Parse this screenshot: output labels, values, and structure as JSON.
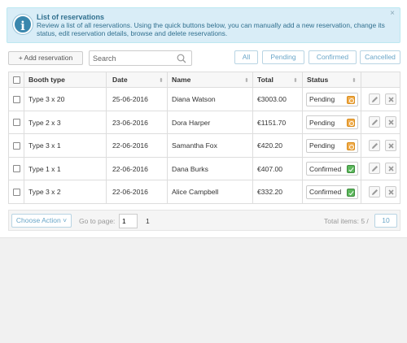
{
  "info": {
    "title": "List of reservations",
    "text": "Review a list of all reservations. Using the quick buttons below, you can manually add a new reservation, change its status, edit reservation details, browse and delete reservations.",
    "icon": "info-icon",
    "close": "×"
  },
  "toolbar": {
    "add_label": "+ Add reservation",
    "search_placeholder": "Search",
    "filters": [
      "All",
      "Pending",
      "Confirmed",
      "Cancelled"
    ]
  },
  "table": {
    "headers": {
      "booth_type": "Booth type",
      "date": "Date",
      "name": "Name",
      "total": "Total",
      "status": "Status"
    },
    "rows": [
      {
        "booth": "Type 3 x 20",
        "date": "25-06-2016",
        "name": "Diana Watson",
        "total": "€3003.00",
        "status": "Pending",
        "status_icon": "clock-icon"
      },
      {
        "booth": "Type 2 x 3",
        "date": "23-06-2016",
        "name": "Dora Harper",
        "total": "€1151.70",
        "status": "Pending",
        "status_icon": "clock-icon"
      },
      {
        "booth": "Type 3 x 1",
        "date": "22-06-2016",
        "name": "Samantha Fox",
        "total": "€420.20",
        "status": "Pending",
        "status_icon": "clock-icon"
      },
      {
        "booth": "Type 1 x 1",
        "date": "22-06-2016",
        "name": "Dana Burks",
        "total": "€407.00",
        "status": "Confirmed",
        "status_icon": "check-icon"
      },
      {
        "booth": "Type 3 x 2",
        "date": "22-06-2016",
        "name": "Alice Campbell",
        "total": "€332.20",
        "status": "Confirmed",
        "status_icon": "check-icon"
      }
    ]
  },
  "footer": {
    "choose_action": "Choose Action ˅",
    "goto_label": "Go to page:",
    "goto_value": "1",
    "page_count": "1",
    "total_label": "Total items: 5 /",
    "per_page": "10"
  },
  "colors": {
    "info_bg": "#d9edf7",
    "accent": "#6aa6c8",
    "pending": "#f0ad4e",
    "confirmed": "#5cb85c"
  }
}
